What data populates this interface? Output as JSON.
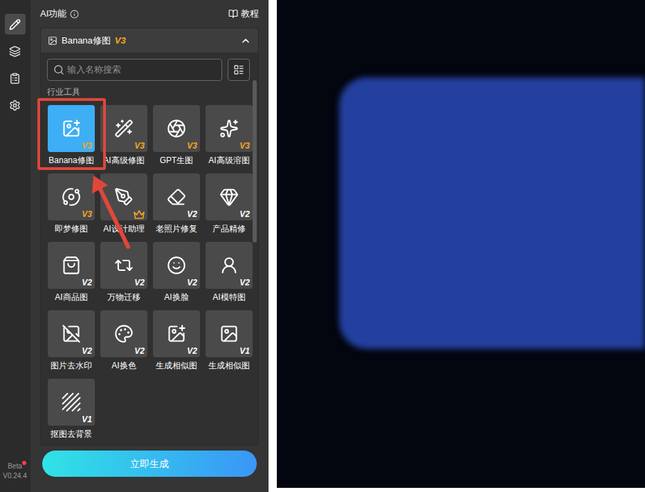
{
  "rail": [
    {
      "selected": true
    },
    {
      "selected": false
    },
    {
      "selected": false
    },
    {
      "selected": false
    }
  ],
  "build": {
    "label": "Beta",
    "number": "V0.24.4",
    "dot": true
  },
  "header": {
    "title": "AI功能",
    "link": "教程"
  },
  "section": {
    "title": "Banana修图",
    "badge": "V3",
    "expanded": true
  },
  "search": {
    "placeholder": "输入名称搜索"
  },
  "group": "行业工具",
  "tools": [
    {
      "label": "Banana修图",
      "badge": "V3",
      "badge_color": "#f5a623",
      "premium": false,
      "selected": true
    },
    {
      "label": "AI高级修图",
      "badge": "V3",
      "badge_color": "#f5a623",
      "premium": false,
      "selected": false
    },
    {
      "label": "GPT生图",
      "badge": "V3",
      "badge_color": "#f5a623",
      "premium": false,
      "selected": false
    },
    {
      "label": "AI高级溶图",
      "badge": "V3",
      "badge_color": "#f5a623",
      "premium": false,
      "selected": false
    },
    {
      "label": "即梦修图",
      "badge": "V3",
      "badge_color": "#f5a623",
      "premium": false,
      "selected": false
    },
    {
      "label": "AI设计助理",
      "badge": "",
      "badge_color": "#f5a623",
      "premium": true,
      "selected": false
    },
    {
      "label": "老照片修复",
      "badge": "V2",
      "badge_color": "#ffffff",
      "premium": false,
      "selected": false
    },
    {
      "label": "产品精修",
      "badge": "V2",
      "badge_color": "#ffffff",
      "premium": false,
      "selected": false
    },
    {
      "label": "AI商品图",
      "badge": "V2",
      "badge_color": "#ffffff",
      "premium": false,
      "selected": false
    },
    {
      "label": "万物迁移",
      "badge": "V2",
      "badge_color": "#ffffff",
      "premium": false,
      "selected": false
    },
    {
      "label": "AI换脸",
      "badge": "V2",
      "badge_color": "#ffffff",
      "premium": false,
      "selected": false
    },
    {
      "label": "AI模特图",
      "badge": "V2",
      "badge_color": "#ffffff",
      "premium": false,
      "selected": false
    },
    {
      "label": "图片去水印",
      "badge": "V2",
      "badge_color": "#ffffff",
      "premium": false,
      "selected": false
    },
    {
      "label": "AI换色",
      "badge": "V2",
      "badge_color": "#ffffff",
      "premium": false,
      "selected": false
    },
    {
      "label": "生成相似图",
      "badge": "V2",
      "badge_color": "#ffffff",
      "premium": false,
      "selected": false
    },
    {
      "label": "生成相似图",
      "badge": "V1",
      "badge_color": "#ffffff",
      "premium": false,
      "selected": false
    },
    {
      "label": "抠图去背景",
      "badge": "V1",
      "badge_color": "#ffffff",
      "premium": false,
      "selected": false
    }
  ],
  "primary_button": "立即生成"
}
